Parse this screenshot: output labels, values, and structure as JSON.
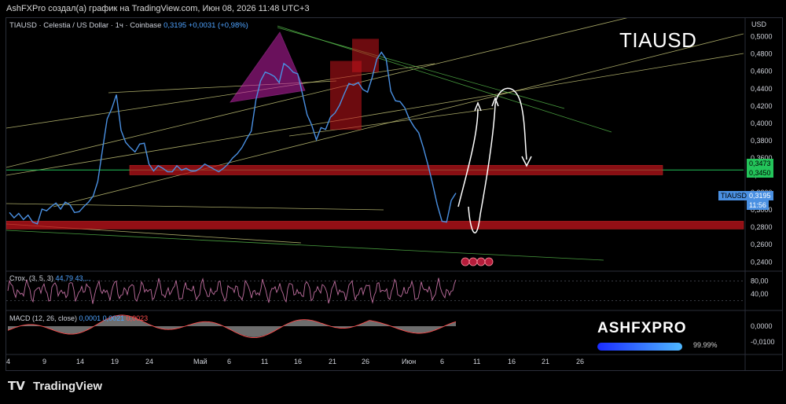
{
  "header": {
    "caption": "AshFXPro создал(а) график на TradingView.com, Июн 08, 2026 11:48 UTC+3"
  },
  "legend": {
    "symbol_info": "TIAUSD · Celestia / US Dollar · 1ч · Coinbase",
    "price": "0,3195",
    "change": "+0,0031 (+0,98%)"
  },
  "overlay": {
    "symbol": "TIAUSD",
    "currency": "USD"
  },
  "price_tags": {
    "green_top": "0,3473",
    "green_bottom": "0,3450",
    "current_symbol": "TIAUSD",
    "current_price": "0,3195",
    "countdown": "11:56"
  },
  "indicators": {
    "stoch_label": "Стох. (3, 5, 3)",
    "stoch_vals": "44,79   43,...",
    "macd_label": "MACD (12, 26, close)",
    "macd_v1": "0,0001",
    "macd_v2": "0,0021",
    "macd_v3": "0,0023"
  },
  "brand": {
    "name": "ASHFXPRO",
    "percent": "99.99%"
  },
  "footer": {
    "logo_text": "TradingView"
  },
  "colors": {
    "price_line": "#4a90e2",
    "zone_red": "#c4141c",
    "support_green": "#23c45a",
    "trend_yellow": "#c7c77a",
    "trend_green": "#55b84a",
    "pattern_magenta": "#c21fa8",
    "stoch": "#c06fa0",
    "macd_hist": "#9b9b9b",
    "macd_line": "#ff4d4d"
  },
  "chart_data": [
    {
      "type": "line",
      "name": "TIAUSD",
      "x_ticks": [
        "4",
        "9",
        "14",
        "19",
        "24",
        "Май",
        "6",
        "11",
        "16",
        "21",
        "26",
        "Июн",
        "6",
        "11",
        "16",
        "21",
        "26"
      ],
      "y_ticks": [
        "0,5000",
        "0,4800",
        "0,4600",
        "0,4400",
        "0,4200",
        "0,4000",
        "0,3800",
        "0,3600",
        "0,3400",
        "0,3200",
        "0,3000",
        "0,2800",
        "0,2600",
        "0,2400"
      ],
      "ylim": [
        0.233,
        0.516
      ],
      "x": [
        0,
        6,
        12,
        18,
        24,
        30,
        36,
        42,
        48,
        54,
        60,
        66,
        72,
        78,
        84,
        90,
        96,
        102,
        108,
        114,
        120,
        126,
        132,
        138,
        144,
        150,
        156,
        162,
        168,
        174,
        180,
        186,
        192,
        198,
        204,
        210,
        216,
        222,
        228,
        234,
        240,
        246,
        252,
        258,
        264,
        270,
        276,
        282,
        288,
        294,
        300,
        306,
        312,
        318,
        324,
        330,
        336,
        342,
        348,
        354,
        360,
        366,
        372,
        378,
        384,
        390,
        396,
        402,
        408,
        414,
        420,
        426,
        432,
        438,
        444,
        450,
        456,
        462,
        468,
        474,
        480,
        486,
        492,
        498,
        504,
        510,
        516,
        522,
        528,
        534,
        540,
        546,
        552,
        558,
        564,
        570,
        576
      ],
      "y": [
        0.297,
        0.291,
        0.296,
        0.289,
        0.294,
        0.286,
        0.284,
        0.301,
        0.299,
        0.304,
        0.308,
        0.301,
        0.309,
        0.306,
        0.297,
        0.298,
        0.304,
        0.309,
        0.316,
        0.333,
        0.369,
        0.405,
        0.417,
        0.433,
        0.392,
        0.378,
        0.372,
        0.367,
        0.376,
        0.377,
        0.353,
        0.345,
        0.351,
        0.348,
        0.344,
        0.344,
        0.351,
        0.346,
        0.348,
        0.345,
        0.345,
        0.348,
        0.353,
        0.35,
        0.347,
        0.344,
        0.348,
        0.353,
        0.36,
        0.365,
        0.372,
        0.382,
        0.391,
        0.427,
        0.449,
        0.459,
        0.457,
        0.454,
        0.447,
        0.469,
        0.465,
        0.459,
        0.457,
        0.434,
        0.41,
        0.398,
        0.381,
        0.395,
        0.393,
        0.407,
        0.412,
        0.421,
        0.434,
        0.446,
        0.444,
        0.447,
        0.439,
        0.436,
        0.453,
        0.474,
        0.482,
        0.474,
        0.437,
        0.426,
        0.425,
        0.418,
        0.405,
        0.396,
        0.389,
        0.372,
        0.352,
        0.33,
        0.306,
        0.287,
        0.286,
        0.311,
        0.3195
      ]
    },
    {
      "type": "line",
      "name": "Стох. (3, 5, 3)",
      "y_ticks": [
        "80,00",
        "40,00"
      ],
      "ylim": [
        0,
        100
      ]
    },
    {
      "type": "bar",
      "name": "MACD (12, 26, close)",
      "y_ticks": [
        "0,0000",
        "-0,0100"
      ],
      "ylim": [
        -0.016,
        0.008
      ]
    }
  ]
}
